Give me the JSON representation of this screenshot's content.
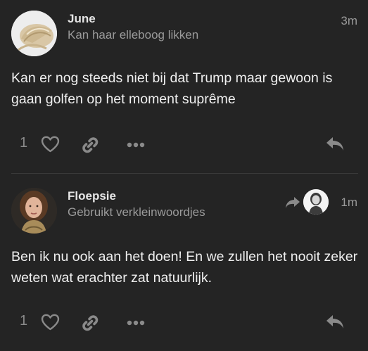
{
  "posts": [
    {
      "username": "June",
      "user_title": "Kan haar elleboog likken",
      "time": "3m",
      "body": "Kan er nog steeds niet bij dat Trump maar gewoon is gaan golfen op het moment suprême",
      "like_count": "1"
    },
    {
      "username": "Floepsie",
      "user_title": "Gebruikt verkleinwoordjes",
      "time": "1m",
      "body": "Ben ik nu ook aan het doen! En we zullen het nooit zeker weten wat erachter zat natuurlijk.",
      "like_count": "1"
    }
  ],
  "icons": {
    "like": "heart-icon",
    "link": "link-icon",
    "more": "more-options-icon",
    "reply": "reply-icon",
    "reply_to": "reply-to-icon"
  },
  "colors": {
    "background": "#242424",
    "text": "#efefef",
    "muted": "#9a9a9a",
    "icon": "#8a8a8a"
  }
}
